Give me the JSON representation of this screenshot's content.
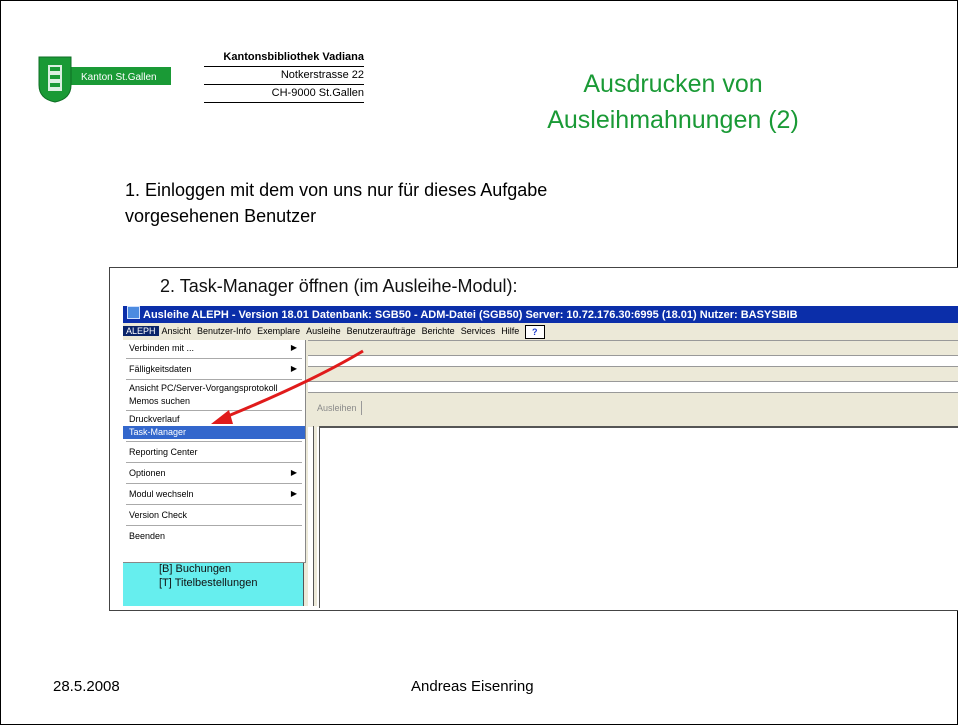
{
  "header": {
    "logo_text": "Kanton St.Gallen",
    "institution": "Kantonsbibliothek Vadiana",
    "street": "Notkerstrasse 22",
    "city": "CH-9000 St.Gallen"
  },
  "title_line1": "Ausdrucken von",
  "title_line2": "Ausleihmahnungen (2)",
  "step1_line1": "1. Einloggen mit dem von uns nur für dieses Aufgabe",
  "step1_line2": "vorgesehenen Benutzer",
  "step2": "2.  Task-Manager öffnen (im Ausleihe-Modul):",
  "window": {
    "title": "Ausleihe ALEPH - Version 18.01  Datenbank:  SGB50 - ADM-Datei (SGB50)  Server: 10.72.176.30:6995 (18.01)  Nutzer:  BASYSBIB",
    "menubar": [
      "ALEPH",
      "Ansicht",
      "Benutzer-Info",
      "Exemplare",
      "Ausleihe",
      "Benutzeraufträge",
      "Berichte",
      "Services",
      "Hilfe"
    ],
    "help_button": "?",
    "tab_label": "Ausleihen",
    "menu": {
      "connect": "Verbinden mit ...",
      "due_dates": "Fälligkeitsdaten",
      "view_log": "Ansicht PC/Server-Vorgangsprotokoll",
      "search_memos": "Memos suchen",
      "print_history": "Druckverlauf",
      "task_manager": "Task-Manager",
      "reporting": "Reporting Center",
      "options": "Optionen",
      "switch_module": "Modul wechseln",
      "version_check": "Version Check",
      "exit": "Beenden"
    },
    "tree": [
      "[B] Buchungen",
      "[T] Titelbestellungen"
    ]
  },
  "footer": {
    "date": "28.5.2008",
    "author": "Andreas Eisenring"
  },
  "colors": {
    "title_green": "#1a9a36",
    "titlebar_blue": "#0b2ea9",
    "menu_highlight": "#3367cc",
    "annotation_arrow": "#e01b1b"
  }
}
